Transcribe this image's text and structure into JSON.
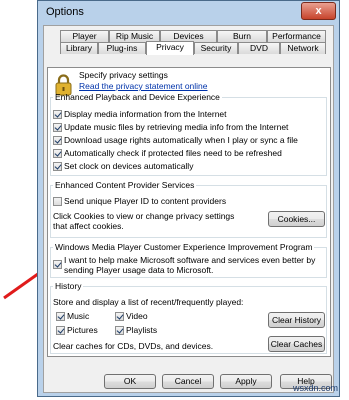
{
  "window": {
    "title": "Options",
    "close_glyph": "x"
  },
  "tabs_row1": [
    "Player",
    "Rip Music",
    "Devices",
    "Burn",
    "Performance"
  ],
  "tabs_row2": [
    "Library",
    "Plug-ins",
    "Privacy",
    "Security",
    "DVD",
    "Network"
  ],
  "active_tab": "Privacy",
  "header": {
    "text": "Specify privacy settings",
    "link": "Read the privacy statement online"
  },
  "playback": {
    "legend": "Enhanced Playback and Device Experience",
    "items": [
      {
        "label": "Display media information from the Internet",
        "checked": true
      },
      {
        "label": "Update music files by retrieving media info from the Internet",
        "checked": true
      },
      {
        "label": "Download usage rights automatically when I play or sync a file",
        "checked": true
      },
      {
        "label": "Automatically check if protected files need to be refreshed",
        "checked": true
      },
      {
        "label": "Set clock on devices automatically",
        "checked": true
      }
    ]
  },
  "content": {
    "legend": "Enhanced Content Provider Services",
    "item": {
      "label": "Send unique Player ID to content providers",
      "checked": false
    },
    "desc_line1": "Click Cookies to view or change privacy settings",
    "desc_line2": "that affect cookies.",
    "cookies_button": "Cookies..."
  },
  "ceip": {
    "legend": "Windows Media Player Customer Experience Improvement Program",
    "line1": "I want to help make Microsoft software and services even better by",
    "line2": "sending Player usage data to Microsoft.",
    "checked": true
  },
  "history": {
    "legend": "History",
    "desc": "Store and display a list of recent/frequently played:",
    "items": [
      {
        "label": "Music",
        "checked": true
      },
      {
        "label": "Video",
        "checked": true
      },
      {
        "label": "Pictures",
        "checked": true
      },
      {
        "label": "Playlists",
        "checked": true
      }
    ],
    "clear_history_button": "Clear History",
    "clear_caches_text": "Clear caches for CDs, DVDs, and devices.",
    "clear_caches_button": "Clear Caches"
  },
  "footer": {
    "ok": "OK",
    "cancel": "Cancel",
    "apply": "Apply",
    "help": "Help"
  },
  "watermark": "wsxdn.com",
  "colors": {
    "annotation_arrow": "#e01b1b",
    "link": "#0033aa",
    "close_button": "#c7432b"
  }
}
